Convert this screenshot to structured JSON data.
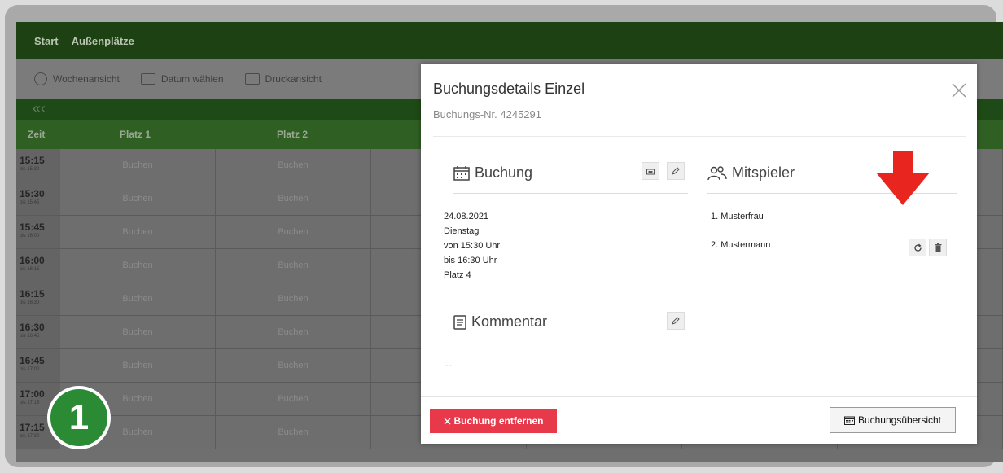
{
  "nav": {
    "items": [
      "Start",
      "Außenplätze"
    ]
  },
  "toolbar": {
    "week_view": "Wochenansicht",
    "choose_date": "Datum wählen",
    "print_view": "Druckansicht"
  },
  "datebar": {
    "prev_glyph": "«‹"
  },
  "grid": {
    "time_header": "Zeit",
    "court_headers": [
      "Platz 1",
      "Platz 2"
    ],
    "slot_label": "Buchen",
    "rows": [
      {
        "time": "15:15",
        "until": "bis 15:30"
      },
      {
        "time": "15:30",
        "until": "bis 15:45"
      },
      {
        "time": "15:45",
        "until": "bis 16:00"
      },
      {
        "time": "16:00",
        "until": "bis 16:15"
      },
      {
        "time": "16:15",
        "until": "bis 16:30"
      },
      {
        "time": "16:30",
        "until": "bis 16:45"
      },
      {
        "time": "16:45",
        "until": "bis 17:00"
      },
      {
        "time": "17:00",
        "until": "bis 17:15"
      },
      {
        "time": "17:15",
        "until": "bis 17:30"
      }
    ]
  },
  "modal": {
    "title": "Buchungsdetails Einzel",
    "booking_number": "Buchungs-Nr. 4245291",
    "booking_section": "Buchung",
    "booking_info": [
      "24.08.2021",
      "Dienstag",
      "von 15:30 Uhr",
      "bis 16:30 Uhr",
      "Platz 4"
    ],
    "players_section": "Mitspieler",
    "players": [
      "1. Musterfrau",
      "2. Mustermann"
    ],
    "comment_section": "Kommentar",
    "comment_value": "--",
    "remove_button": "Buchung entfernen",
    "overview_button": "Buchungsübersicht"
  },
  "annotation": {
    "step_number": "1",
    "arrow_color": "#e8251f",
    "badge_color": "#2b8a34"
  },
  "colors": {
    "dark_green": "#1e4114",
    "header_green": "#2f5f23",
    "danger": "#e8394a"
  }
}
